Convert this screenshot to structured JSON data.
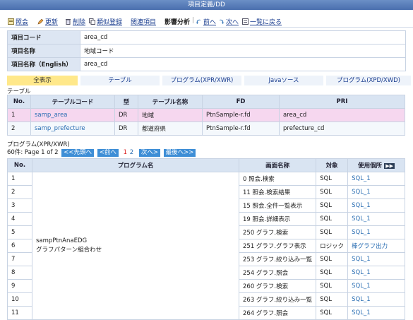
{
  "window": {
    "title": "項目定義/DD"
  },
  "toolbar": {
    "items": [
      {
        "label": "照会",
        "icon": "search-icon"
      },
      {
        "label": "更新",
        "icon": "update-icon"
      },
      {
        "label": "削除",
        "icon": "delete-icon"
      },
      {
        "label": "類似登録",
        "icon": "copy-icon"
      },
      {
        "label": "関連項目",
        "icon": ""
      },
      {
        "label": "影響分析",
        "icon": ""
      },
      {
        "label": "前へ",
        "icon": "prev-icon"
      },
      {
        "label": "次へ",
        "icon": "next-icon"
      },
      {
        "label": "一覧に戻る",
        "icon": "list-icon"
      }
    ]
  },
  "info": {
    "rows": [
      {
        "label": "項目コード",
        "value": "area_cd"
      },
      {
        "label": "項目名称",
        "value": "地域コード"
      },
      {
        "label": "項目名称（English）",
        "value": "area_cd"
      }
    ]
  },
  "tabs": [
    "全表示",
    "テーブル",
    "プログラム(XPR/XWR)",
    "Javaソース",
    "プログラム(XPD/XWD)"
  ],
  "table_section": {
    "label": "テーブル",
    "headers": [
      "No.",
      "テーブルコード",
      "型",
      "テーブル名称",
      "FD",
      "PRI"
    ],
    "rows": [
      [
        "1",
        "samp_area",
        "DR",
        "地域",
        "PtnSample-r.fd",
        "area_cd"
      ],
      [
        "2",
        "samp_prefecture",
        "DR",
        "都道府県",
        "PtnSample-r.fd",
        "prefecture_cd"
      ]
    ]
  },
  "program_section": {
    "label": "プログラム(XPR/XWR)",
    "pager": {
      "summary": "60件: Page 1 of 2",
      "first": "<<先頭へ",
      "prev": "<前へ",
      "current": "1",
      "page2": "2",
      "next": "次へ>",
      "last": "最後へ>>"
    },
    "headers": [
      "No.",
      "プログラム名",
      "画面名称",
      "対象",
      "使用個所"
    ],
    "expand_label": "▶▶",
    "program_name_line1": "sampPtnAnaEDG",
    "program_name_line2": "グラフパターン組合わせ",
    "rows": [
      [
        "1",
        "0 照会.検索",
        "SQL",
        "SQL_1"
      ],
      [
        "2",
        "11 照会.検索結果",
        "SQL",
        "SQL_1"
      ],
      [
        "3",
        "15 照会.全件一覧表示",
        "SQL",
        "SQL_1"
      ],
      [
        "4",
        "19 照会.詳細表示",
        "SQL",
        "SQL_1"
      ],
      [
        "5",
        "250 グラフ.検索",
        "SQL",
        "SQL_1"
      ],
      [
        "6",
        "251 グラフ.グラフ表示",
        "ロジック",
        "棒グラフ出力"
      ],
      [
        "7",
        "253 グラフ.絞り込み一覧",
        "SQL",
        "SQL_1"
      ],
      [
        "8",
        "254 グラフ.照会",
        "SQL",
        "SQL_1"
      ],
      [
        "9",
        "260 グラフ.検索",
        "SQL",
        "SQL_1"
      ],
      [
        "10",
        "263 グラフ.絞り込み一覧",
        "SQL",
        "SQL_1"
      ],
      [
        "11",
        "264 グラフ.照会",
        "SQL",
        "SQL_1"
      ]
    ]
  }
}
